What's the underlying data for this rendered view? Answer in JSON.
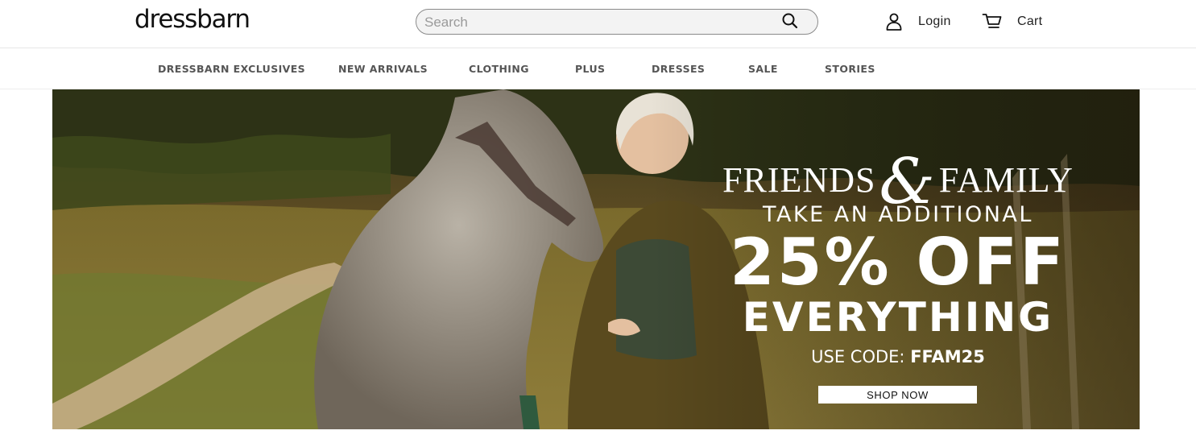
{
  "header": {
    "logo": "dressbarn",
    "search": {
      "placeholder": "Search",
      "value": "",
      "icon": "search-icon"
    },
    "login": {
      "label": "Login",
      "icon": "user-icon"
    },
    "cart": {
      "label": "Cart",
      "icon": "cart-icon"
    }
  },
  "nav": {
    "items": [
      {
        "label": "DRESSBARN EXCLUSIVES"
      },
      {
        "label": "NEW ARRIVALS"
      },
      {
        "label": "CLOTHING"
      },
      {
        "label": "PLUS"
      },
      {
        "label": "DRESSES"
      },
      {
        "label": "SALE"
      },
      {
        "label": "STORIES"
      }
    ]
  },
  "hero": {
    "headline_part1": "FRIENDS",
    "headline_amp": "&",
    "headline_part2": "FAMILY",
    "line1": "TAKE AN ADDITIONAL",
    "line2": "25% OFF",
    "line3": "EVERYTHING",
    "code_prefix": "USE CODE: ",
    "code": "FFAM25",
    "cta": "SHOP NOW"
  },
  "colors": {
    "nav_text": "#555555",
    "search_bg": "#f3f3f3",
    "hero_text": "#ffffff"
  }
}
